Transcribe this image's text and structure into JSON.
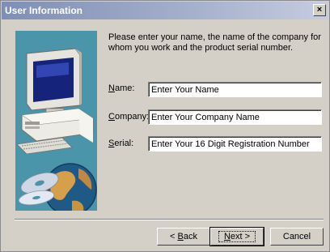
{
  "window": {
    "title": "User Information",
    "close_glyph": "×"
  },
  "intro_text": "Please enter your name, the name of the company for whom you work and the product serial number.",
  "fields": {
    "name": {
      "label_mnemonic": "N",
      "label_rest": "ame:",
      "value": "Enter Your Name"
    },
    "company": {
      "label_mnemonic": "C",
      "label_rest": "ompany:",
      "value": "Enter Your Company Name"
    },
    "serial": {
      "label_mnemonic": "S",
      "label_rest": "erial:",
      "value": "Enter Your 16 Digit Registration Number"
    }
  },
  "buttons": {
    "back_prefix": "< ",
    "back_mnemonic": "B",
    "back_rest": "ack",
    "next_mnemonic": "N",
    "next_rest": "ext >",
    "cancel": "Cancel"
  },
  "icons": {
    "art": "computer-cd-globe-illustration",
    "close": "close-icon"
  },
  "colors": {
    "titlebar_start": "#7f8eb5",
    "dialog_bg": "#d4d0c8",
    "art_bg": "#4a95aa"
  }
}
